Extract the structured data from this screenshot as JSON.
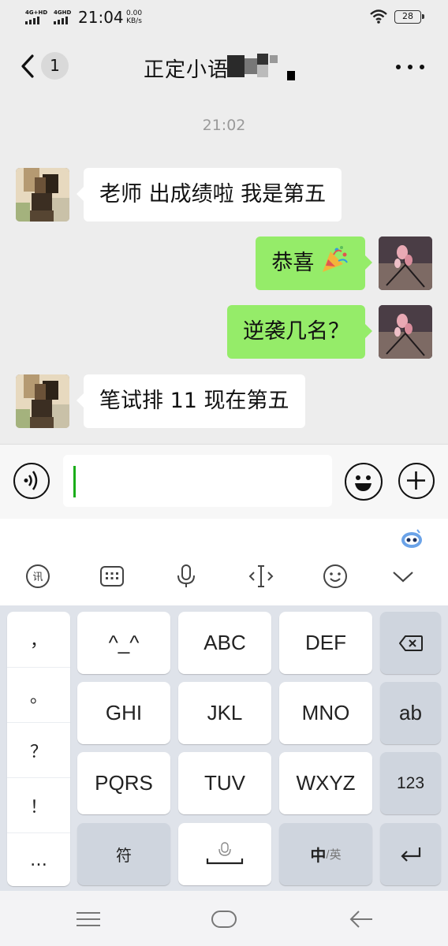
{
  "status_bar": {
    "signal1_label": "4G+HD",
    "signal2_label": "4GHD",
    "time": "21:04",
    "net_speed_value": "0.00",
    "net_speed_unit": "KB/s",
    "battery": "28",
    "icons": [
      "signal-icon",
      "wifi-icon",
      "battery-icon"
    ]
  },
  "nav": {
    "back_icon": "chevron-left-icon",
    "unread_count": "1",
    "title": "正定小语",
    "more_icon": "more-dots-icon"
  },
  "chat": {
    "timestamp": "21:02",
    "messages": [
      {
        "side": "left",
        "text": "老师 出成绩啦 我是第五"
      },
      {
        "side": "right",
        "text": "恭喜",
        "emoji": "party-popper-icon"
      },
      {
        "side": "right",
        "text": "逆袭几名？"
      },
      {
        "side": "left",
        "text": "笔试排 11 现在第五"
      }
    ]
  },
  "input_bar": {
    "value": "",
    "icons": [
      "voice-icon",
      "emoji-icon",
      "plus-icon"
    ]
  },
  "keyboard": {
    "toolbar_icons": [
      "handwriting-icon",
      "keyboard-icon",
      "microphone-icon",
      "cursor-icon",
      "face-icon",
      "collapse-icon",
      "assistant-icon"
    ],
    "punctuation": [
      "，",
      "。",
      "？",
      "！",
      "…"
    ],
    "keys": {
      "k1": "^_^",
      "k2": "ABC",
      "k3": "DEF",
      "k4": "GHI",
      "k5": "JKL",
      "k6": "MNO",
      "k7": "PQRS",
      "k8": "TUV",
      "k9": "WXYZ",
      "ab": "ab",
      "num": "123",
      "symbol": "符",
      "lang_primary": "中",
      "lang_secondary": "/英"
    },
    "func_icons": [
      "backspace-icon",
      "space-mic-icon",
      "enter-icon"
    ]
  },
  "system_nav": {
    "icons": [
      "menu-icon",
      "home-icon",
      "back-arrow-icon"
    ]
  }
}
